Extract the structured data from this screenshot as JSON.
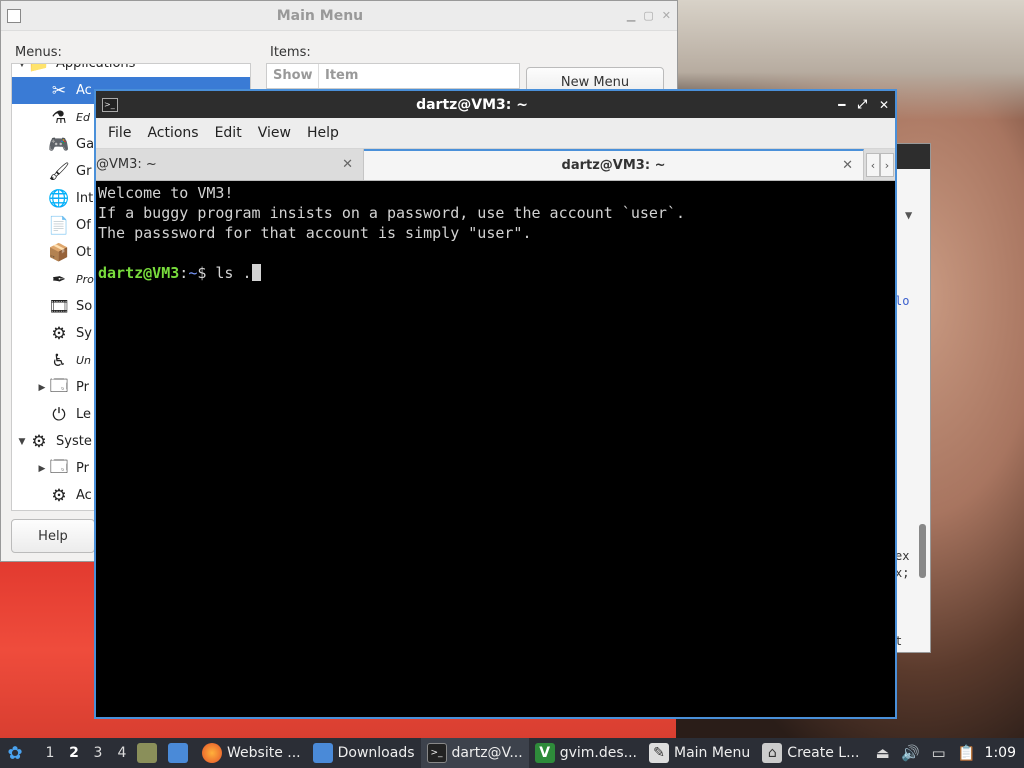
{
  "main_menu": {
    "title": "Main Menu",
    "menus_label": "Menus:",
    "items_label": "Items:",
    "items_columns": [
      "Show",
      "Item"
    ],
    "new_menu_button": "New Menu",
    "help_button": "Help",
    "tree": [
      {
        "label": "Applications",
        "icon": "folder-icon",
        "expander": "▼",
        "indent": 0
      },
      {
        "label": "Ac",
        "icon": "accessories-icon",
        "selected": true,
        "indent": 1
      },
      {
        "label": "Ed",
        "icon": "flask-icon",
        "italic": true,
        "indent": 1
      },
      {
        "label": "Ga",
        "icon": "gamepad-icon",
        "indent": 1
      },
      {
        "label": "Gr",
        "icon": "graphics-icon",
        "indent": 1
      },
      {
        "label": "Int",
        "icon": "globe-icon",
        "indent": 1
      },
      {
        "label": "Of",
        "icon": "office-icon",
        "indent": 1
      },
      {
        "label": "Ot",
        "icon": "other-icon",
        "indent": 1
      },
      {
        "label": "Pro",
        "icon": "programming-icon",
        "italic": true,
        "indent": 1
      },
      {
        "label": "So",
        "icon": "film-icon",
        "indent": 1
      },
      {
        "label": "Sy",
        "icon": "gear-icon",
        "indent": 1
      },
      {
        "label": "Un",
        "icon": "accessibility-icon",
        "italic": true,
        "indent": 1
      },
      {
        "label": "Pr",
        "icon": "preferences-icon",
        "expander": "▶",
        "indent": 1
      },
      {
        "label": "Le",
        "icon": "power-icon",
        "indent": 1
      },
      {
        "label": "Syste",
        "icon": "gear-icon",
        "expander": "▼",
        "indent": 0
      },
      {
        "label": "Pr",
        "icon": "preferences-icon",
        "expander": "▶",
        "indent": 1
      },
      {
        "label": "Ac",
        "icon": "gear-icon",
        "indent": 1
      }
    ]
  },
  "terminal": {
    "title": "dartz@VM3: ~",
    "menu": [
      "File",
      "Actions",
      "Edit",
      "View",
      "Help"
    ],
    "tabs": [
      {
        "label": "@VM3: ~",
        "close": "✕"
      },
      {
        "label": "dartz@VM3: ~",
        "close": "✕",
        "active": true
      }
    ],
    "tab_prev": "‹",
    "tab_next": "›",
    "lines": [
      "Welcome to VM3!",
      "If a buggy program insists on a password, use the account `user`.",
      "The passsword for that account is simply \"user\"."
    ],
    "prompt_user": "dartz@VM3",
    "prompt_colon": ":",
    "prompt_path": "~",
    "prompt_symbol": "$ ",
    "command": "ls ."
  },
  "right_window": {
    "fragments": [
      "lo",
      "ex",
      "x;",
      "t"
    ]
  },
  "taskbar": {
    "workspaces": [
      "1",
      "2",
      "3",
      "4"
    ],
    "current_workspace": "2",
    "apps": [
      {
        "label": "Website ...",
        "icon": "firefox-icon"
      },
      {
        "label": "Downloads",
        "icon": "folder-icon"
      },
      {
        "label": "dartz@V...",
        "icon": "terminal-icon",
        "active": true
      },
      {
        "label": "gvim.des...",
        "icon": "vim-icon"
      },
      {
        "label": "Main Menu",
        "icon": "menu-editor-icon"
      },
      {
        "label": "Create L...",
        "icon": "launcher-icon"
      }
    ],
    "clock": "1:09"
  }
}
